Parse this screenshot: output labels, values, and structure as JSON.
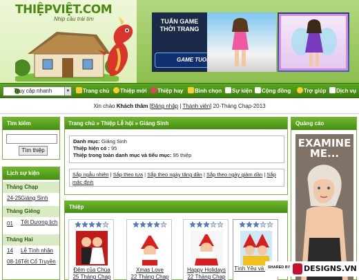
{
  "header": {
    "logo_text": "THIỆPVIỆT.COM",
    "slogan": "Nhịp cầu trái tim",
    "ad_title": "TUẤN GAME THỜI TRANG",
    "ad_logo": "GAME TUOI.com"
  },
  "nav": {
    "quick_access": "Truy cập nhanh",
    "items": [
      {
        "label": "Trang chủ",
        "icon": "home-icon",
        "color": "#ffcc33"
      },
      {
        "label": "Thiệp mới",
        "icon": "new-icon",
        "color": "#ffcc33"
      },
      {
        "label": "Thiệp hay",
        "icon": "heart-icon",
        "color": "#e84060"
      },
      {
        "label": "Bình chọn",
        "icon": "star-icon",
        "color": "#ffcc33"
      },
      {
        "label": "Sự kiện",
        "icon": "calendar-icon",
        "color": "#ffffff"
      },
      {
        "label": "Cộng đồng",
        "icon": "community-icon",
        "color": "#ffffff"
      },
      {
        "label": "Trợ giúp",
        "icon": "help-icon",
        "color": "#ffcc33"
      },
      {
        "label": "Dịch vụ",
        "icon": "cart-icon",
        "color": "#ffffff"
      }
    ]
  },
  "welcome": {
    "greeting": "Xin chào",
    "user": "Khách thăm",
    "login": "Đăng nhập",
    "register": "Thành viên",
    "date": "20-Tháng Chạp-2013"
  },
  "sidebar": {
    "search_title": "Tìm kiếm",
    "search_value": "",
    "search_button": "Tìm thiệp",
    "events_title": "Lịch sự kiện",
    "months": [
      {
        "name": "Tháng Chạp",
        "events": [
          {
            "date": "24-25",
            "name": "Giáng Sinh"
          }
        ]
      },
      {
        "name": "Tháng Giêng",
        "events": [
          {
            "date": "01",
            "name": "Tết Dương lịch"
          }
        ]
      },
      {
        "name": "Tháng Hai",
        "events": [
          {
            "date": "14",
            "name": "Lễ Tình nhân"
          },
          {
            "date": "08-16",
            "name": "Tết Cổ Truyền"
          }
        ]
      }
    ]
  },
  "content": {
    "breadcrumb": "Trang chủ » Thiệp Lễ hội » Giáng Sinh",
    "category_label": "Danh mục:",
    "category": "Giáng Sinh",
    "count_label": "Thiệp hiện có :",
    "count": "95",
    "total_label": "Thiệp trong toàn danh mục và tiểu mục:",
    "total": "95 thiệp",
    "sort_links": [
      "Sắp ngẫu nhiên",
      "Sắp theo tựa",
      "Sắp theo ngày tăng dần",
      "Sắp theo ngày giảm dần",
      "Sắp mặc định"
    ],
    "cards_title": "Thiệp",
    "cards": [
      {
        "name": "Đêm của Chúa",
        "date": "25 Tháng Chạp",
        "stars": 4
      },
      {
        "name": "Xmas Love",
        "date": "22 Tháng Chạp",
        "stars": 4
      },
      {
        "name": "Happy Holidays",
        "date": "22 Tháng Chạp",
        "stars": 3
      },
      {
        "name": "Tình Yêu và Phúc",
        "date": "",
        "stars": 3
      }
    ]
  },
  "ads": {
    "title": "Quảng cáo",
    "text": "EXAMINE ME..."
  },
  "watermark": {
    "shared_by": "SHARED BY",
    "site": "DESIGNS.VN"
  }
}
